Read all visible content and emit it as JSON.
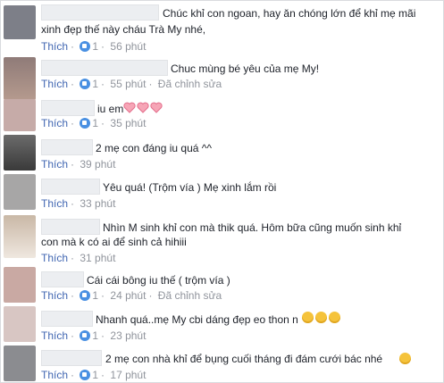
{
  "actions": {
    "like": "Thích",
    "sep": "·",
    "edited": "Đã chỉnh sửa"
  },
  "comments": [
    {
      "text": "Chúc khỉ con ngoan, hay ăn chóng lớn để khỉ mẹ mãi",
      "text2": "xinh đẹp thế này cháu Trà My nhé,",
      "likes": "1",
      "time": "56 phút",
      "edited": false
    },
    {
      "text": "Chuc mùng bé yêu của mẹ My!",
      "likes": "1",
      "time": "55 phút",
      "edited": true
    },
    {
      "text": "iu em",
      "likes": "1",
      "time": "35 phút",
      "edited": false
    },
    {
      "text": "2 mẹ con đáng iu quá ^^",
      "time": "39 phút",
      "edited": false
    },
    {
      "text": "Yêu quá! (Trộm vía ) Mẹ xinh lắm rồi",
      "time": "33 phút",
      "edited": false
    },
    {
      "text": "Nhìn M sinh khỉ con mà thik quá. Hôm bữa cũng muốn sinh khỉ",
      "text2": "con mà k có ai để sinh cả hihiii",
      "time": "31 phút",
      "edited": false
    },
    {
      "text": "Cái cái bông iu thế ( trộm vía )",
      "likes": "1",
      "time": "24 phút",
      "edited": true
    },
    {
      "text": "Nhanh quá..mẹ My cbi dáng đẹp eo thon n",
      "likes": "1",
      "time": "23 phút",
      "edited": false
    },
    {
      "text": "2 mẹ con nhà khỉ để bụng cuối tháng đi đám cưới bác nhé",
      "likes": "1",
      "time": "17 phút",
      "edited": false
    }
  ],
  "colors": {
    "link": "#4267b2",
    "meta": "#90949c",
    "text": "#1d2129",
    "like": "#4a90e2"
  },
  "icons": {
    "like": "like-thumb-icon",
    "heart": "pink-heart-icon",
    "emoji": "laughing-emoji-icon"
  }
}
